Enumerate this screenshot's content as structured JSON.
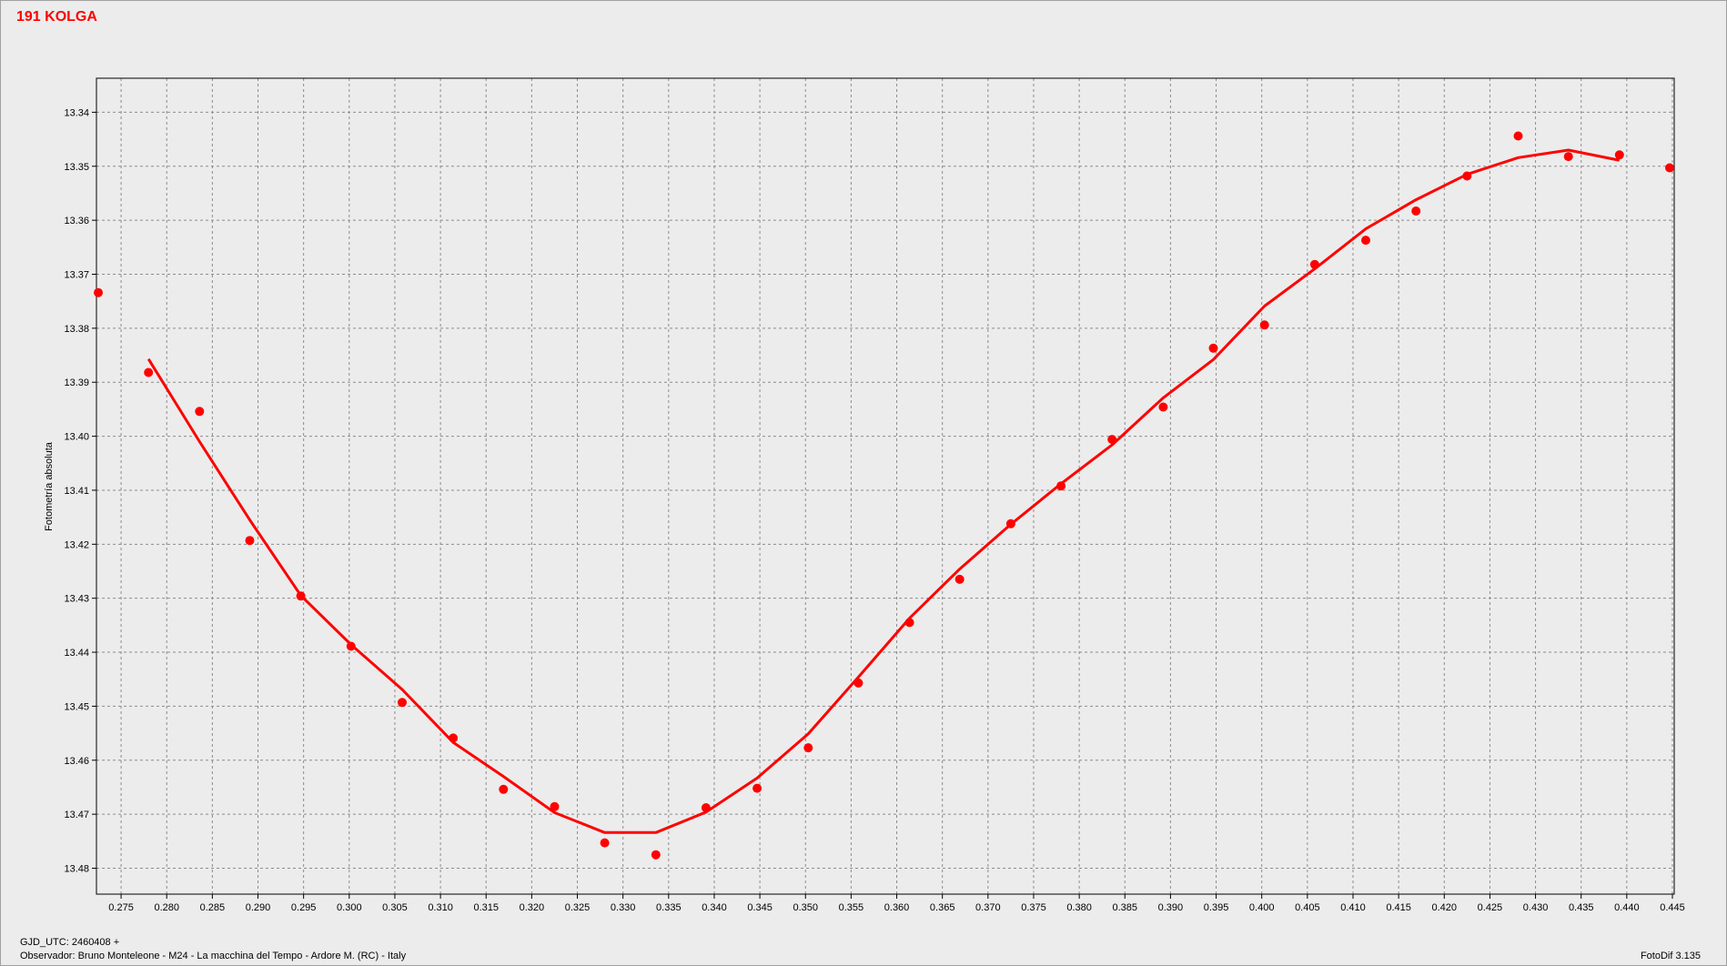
{
  "title": "191 KOLGA",
  "footer": {
    "gjd": "GJD_UTC: 2460408 +",
    "observer": "Observador: Bruno Monteleone - M24 - La macchina del Tempo - Ardore M. (RC) - Italy",
    "version": "FotoDif 3.135"
  },
  "colors": {
    "accent": "#ff0000",
    "background": "#ececec",
    "grid": "#8c8c8c"
  },
  "chart_data": {
    "type": "scatter",
    "title": "191 KOLGA",
    "xlabel": "",
    "ylabel": "Fotometría absoluta",
    "xlim": [
      0.2723,
      0.4452
    ],
    "ylim": [
      13.3337,
      13.4848
    ],
    "y_inverted": true,
    "grid": true,
    "x_ticks": [
      "0.275",
      "0.280",
      "0.285",
      "0.290",
      "0.295",
      "0.300",
      "0.305",
      "0.310",
      "0.315",
      "0.320",
      "0.325",
      "0.330",
      "0.335",
      "0.340",
      "0.345",
      "0.350",
      "0.355",
      "0.360",
      "0.365",
      "0.370",
      "0.375",
      "0.380",
      "0.385",
      "0.390",
      "0.395",
      "0.400",
      "0.405",
      "0.410",
      "0.415",
      "0.420",
      "0.425",
      "0.430",
      "0.435",
      "0.440",
      "0.445"
    ],
    "y_ticks": [
      "13.34",
      "13.35",
      "13.36",
      "13.37",
      "13.38",
      "13.39",
      "13.40",
      "13.41",
      "13.42",
      "13.43",
      "13.44",
      "13.45",
      "13.46",
      "13.47",
      "13.48"
    ],
    "series": [
      {
        "kind": "points",
        "color": "#ff0000",
        "x": [
          0.2725,
          0.278,
          0.2836,
          0.2891,
          0.2947,
          0.3002,
          0.3058,
          0.3114,
          0.3169,
          0.3225,
          0.328,
          0.3336,
          0.3391,
          0.3447,
          0.3503,
          0.3558,
          0.3614,
          0.3669,
          0.3725,
          0.378,
          0.3836,
          0.3892,
          0.3947,
          0.4003,
          0.4058,
          0.4114,
          0.4169,
          0.4225,
          0.4281,
          0.4336,
          0.4392,
          0.4447
        ],
        "y": [
          13.3734,
          13.3882,
          13.3954,
          13.4193,
          13.4296,
          13.4389,
          13.4493,
          13.4559,
          13.4654,
          13.4686,
          13.4753,
          13.4775,
          13.4688,
          13.4652,
          13.4577,
          13.4457,
          13.4345,
          13.4265,
          13.4162,
          13.4092,
          13.4006,
          13.3946,
          13.3837,
          13.3794,
          13.3682,
          13.3637,
          13.3583,
          13.3518,
          13.3444,
          13.3482,
          13.3479,
          13.3503
        ]
      },
      {
        "kind": "fit",
        "color": "#ff0000",
        "x": [
          0.278,
          0.2836,
          0.2891,
          0.2947,
          0.3002,
          0.3058,
          0.3114,
          0.3169,
          0.3225,
          0.328,
          0.3336,
          0.3391,
          0.3447,
          0.3503,
          0.3558,
          0.3614,
          0.3669,
          0.3725,
          0.378,
          0.3836,
          0.3892,
          0.3947,
          0.4003,
          0.4058,
          0.4114,
          0.4169,
          0.4225,
          0.4281,
          0.4336,
          0.4392
        ],
        "y": [
          13.3857,
          13.401,
          13.4155,
          13.4295,
          13.4386,
          13.4469,
          13.4567,
          13.463,
          13.4697,
          13.4734,
          13.4734,
          13.4696,
          13.4633,
          13.4551,
          13.4446,
          13.4337,
          13.4246,
          13.4163,
          13.4088,
          13.4016,
          13.3929,
          13.3858,
          13.3759,
          13.369,
          13.3616,
          13.3562,
          13.3515,
          13.3484,
          13.347,
          13.3489
        ]
      }
    ]
  }
}
